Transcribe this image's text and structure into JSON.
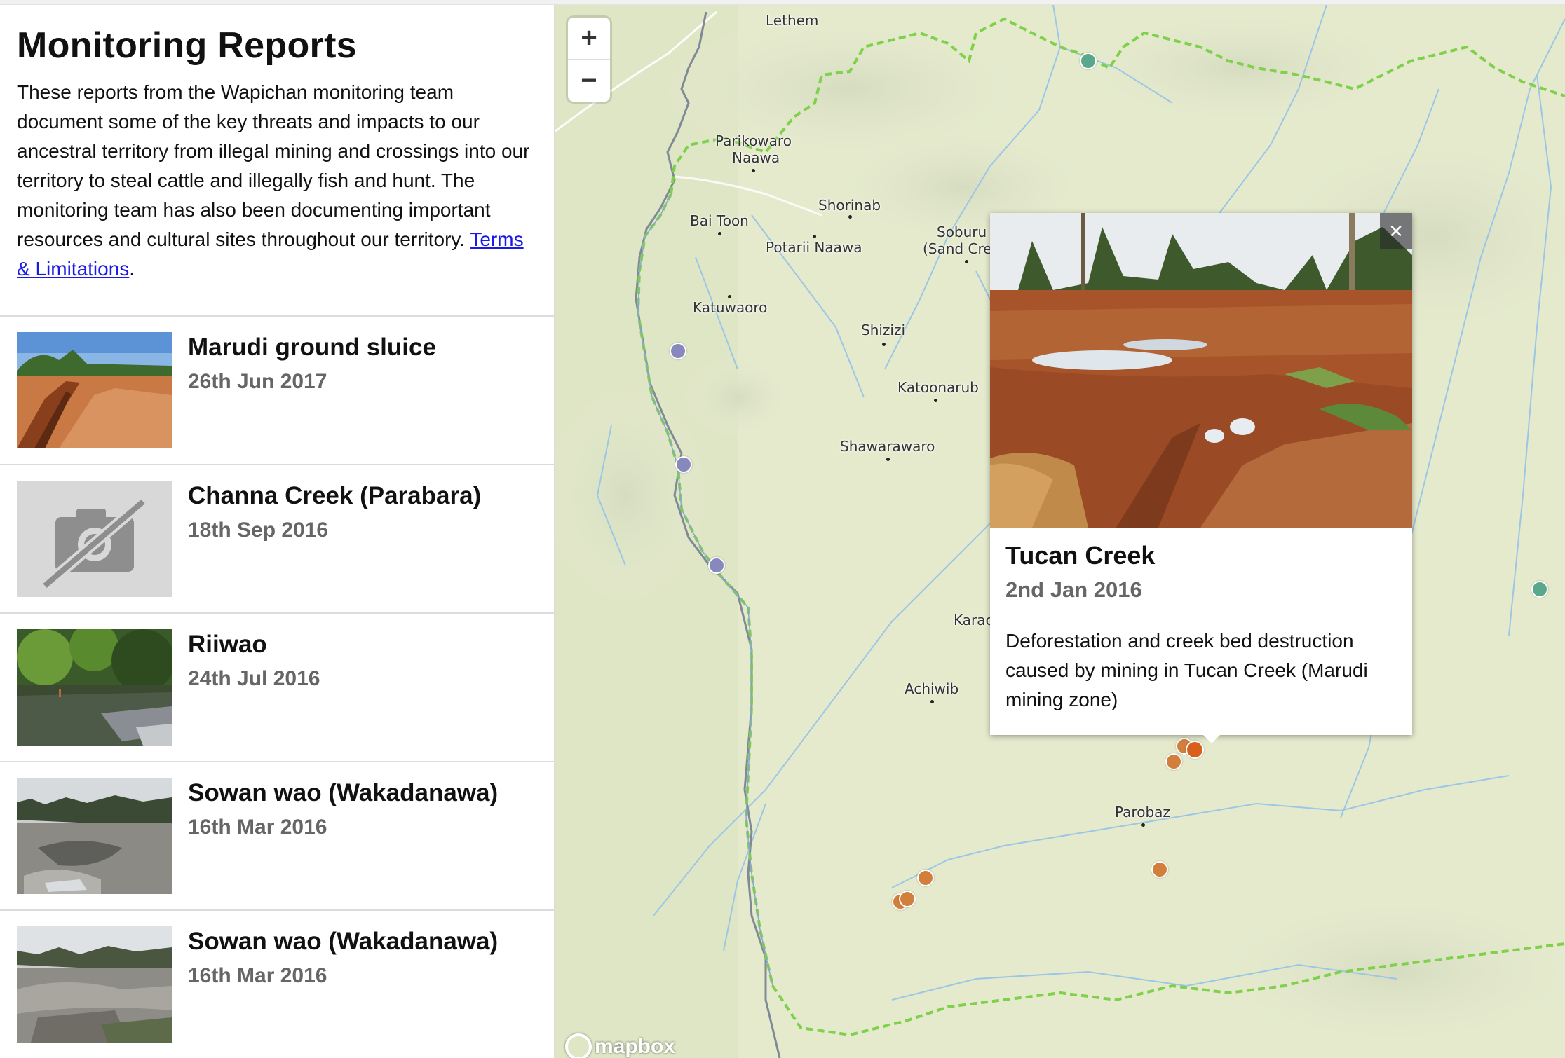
{
  "sidebar": {
    "title": "Monitoring Reports",
    "intro": "These reports from the Wapichan monitoring team document some of the key threats and impacts to our ancestral territory from illegal mining and crossings into our territory to steal cattle and illegally fish and hunt. The monitoring team has also been documenting important resources and cultural sites throughout our territory.",
    "terms_link": "Terms & Limitations",
    "terms_suffix": ".",
    "reports": [
      {
        "title": "Marudi ground sluice",
        "date": "26th Jun 2017",
        "image": "photo"
      },
      {
        "title": "Channa Creek (Parabara)",
        "date": "18th Sep 2016",
        "image": "no-photo-icon"
      },
      {
        "title": "Riiwao",
        "date": "24th Jul 2016",
        "image": "photo"
      },
      {
        "title": "Sowan wao (Wakadanawa)",
        "date": "16th Mar 2016",
        "image": "photo"
      },
      {
        "title": "Sowan wao (Wakadanawa)",
        "date": "16th Mar 2016",
        "image": "photo"
      }
    ]
  },
  "map": {
    "zoom_in": "+",
    "zoom_out": "−",
    "places": [
      "Lethem",
      "Parikowaro",
      "Naawa",
      "Shorinab",
      "Bai Toon",
      "Potarii Naawa",
      "Soburu",
      "(Sand Cre",
      "Katuwaoro",
      "Shizizi",
      "Katoonarub",
      "Shawarawaro",
      "Karac",
      "Achiwib",
      "Parobaz"
    ],
    "logo": "mapbox",
    "colors": {
      "marker_blue": "#8789bd",
      "marker_green": "#5aa88c",
      "marker_orange": "#d27f3c",
      "boundary": "#7fd04a",
      "river": "#9cc6e6"
    }
  },
  "popup": {
    "title": "Tucan Creek",
    "date": "2nd Jan 2016",
    "description": "Deforestation and creek bed destruction caused by mining in Tucan Creek (Marudi mining zone)",
    "close": "×"
  }
}
